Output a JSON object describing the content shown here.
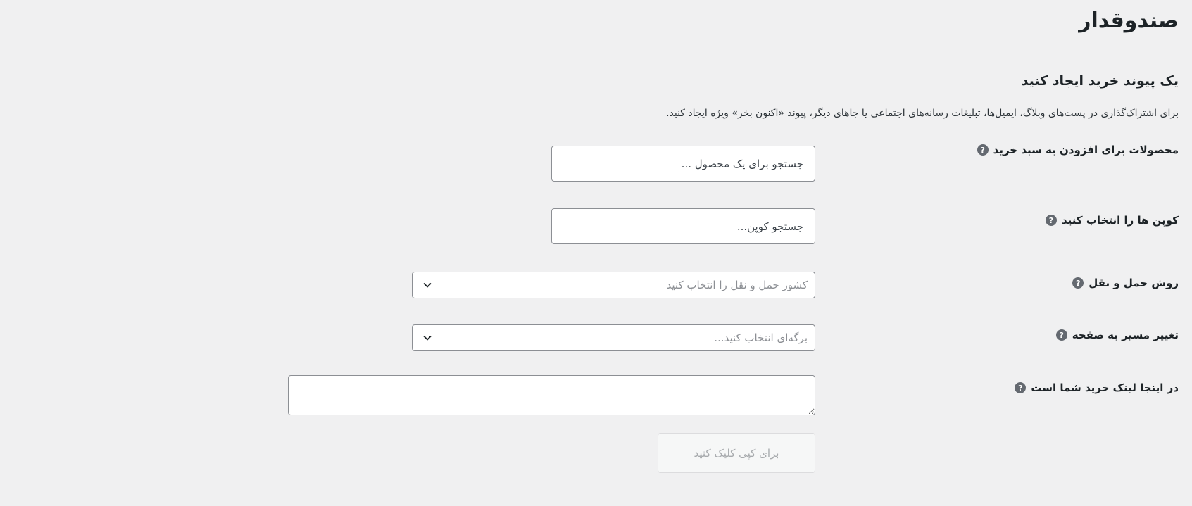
{
  "page": {
    "title": "صندوقدار"
  },
  "section": {
    "title": "یک پیوند خرید ایجاد کنید",
    "description": "برای اشتراک‌گذاری در پست‌های وبلاگ، ایمیل‌ها، تبلیغات رسانه‌های اجتماعی یا جاهای دیگر، پیوند «اکنون بخر» ویژه ایجاد کنید."
  },
  "help_icon_glyph": "?",
  "form": {
    "products": {
      "label": "محصولات برای افزودن به سبد خرید",
      "placeholder": "جستجو برای یک محصول ..."
    },
    "coupons": {
      "label": "کوپن ها را انتخاب کنید",
      "placeholder": "جستجو کوپن..."
    },
    "shipping": {
      "label": "روش حمل و نقل",
      "placeholder": "کشور حمل و نقل را انتخاب کنید"
    },
    "redirect": {
      "label": "تغییر مسیر به صفحه",
      "placeholder": "برگه‌ای انتخاب کنید..."
    },
    "link": {
      "label": "در اینجا لینک خرید شما است",
      "value": ""
    },
    "copy_button_label": "برای کپی کلیک کنید"
  },
  "colors": {
    "background": "#f0f0f1",
    "text": "#1d2327",
    "help_icon": "#646970",
    "border": "#8c8f94",
    "disabled_text": "#a7aaad"
  }
}
